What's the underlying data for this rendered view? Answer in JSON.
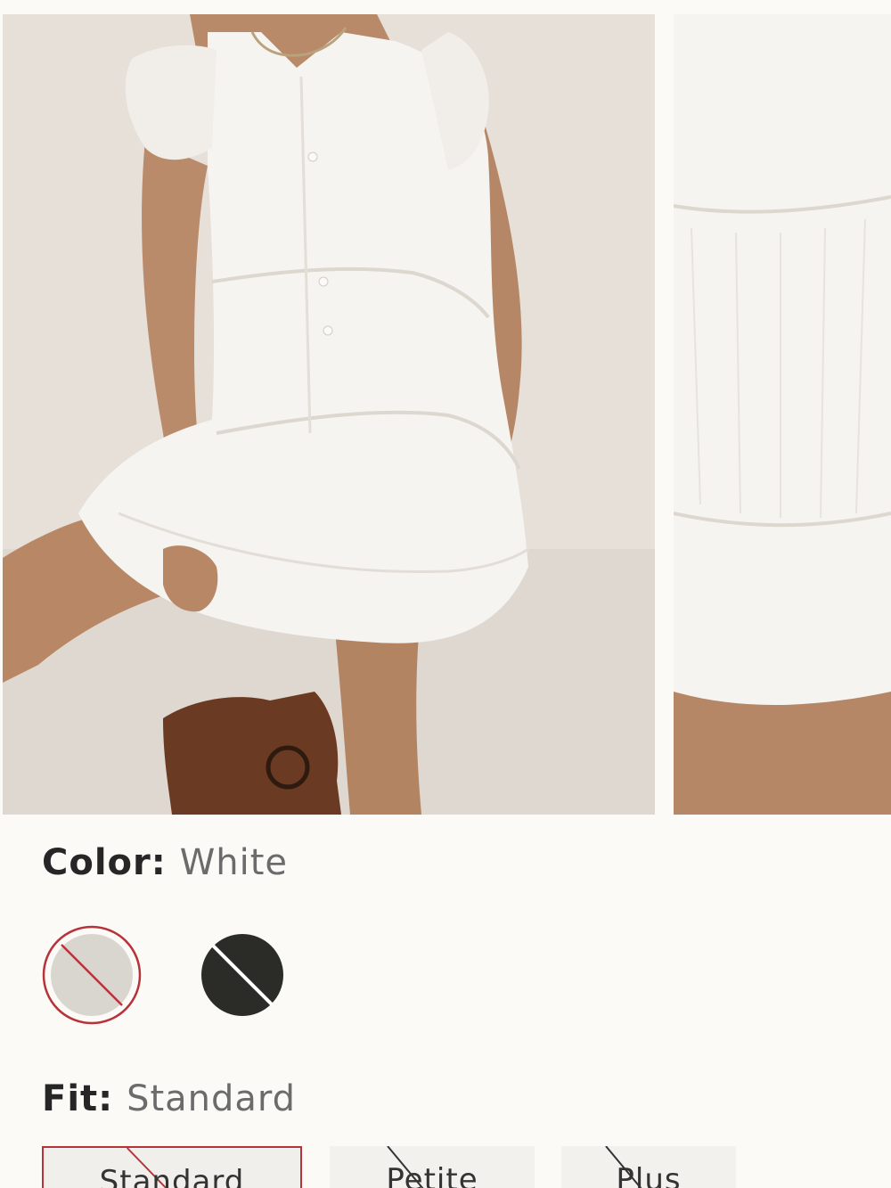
{
  "product": {
    "images": [
      {
        "name": "model-front-view",
        "alt": ""
      },
      {
        "name": "skirt-detail-view",
        "alt": ""
      }
    ]
  },
  "color": {
    "label": "Color:",
    "selected": "White",
    "swatches": [
      {
        "name": "White",
        "hex": "#d9d5cf",
        "selected": true,
        "unavailable": true
      },
      {
        "name": "Black",
        "hex": "#2b2b28",
        "selected": false,
        "unavailable": true
      }
    ]
  },
  "fit": {
    "label": "Fit:",
    "selected": "Standard",
    "options": [
      {
        "label": "Standard",
        "selected": true,
        "unavailable": true
      },
      {
        "label": "Petite",
        "selected": false,
        "unavailable": true
      },
      {
        "label": "Plus",
        "selected": false,
        "unavailable": true
      }
    ]
  },
  "colors": {
    "accent": "#b8323a",
    "background": "#fbfaf7",
    "option_bg": "#f3f1ee"
  }
}
